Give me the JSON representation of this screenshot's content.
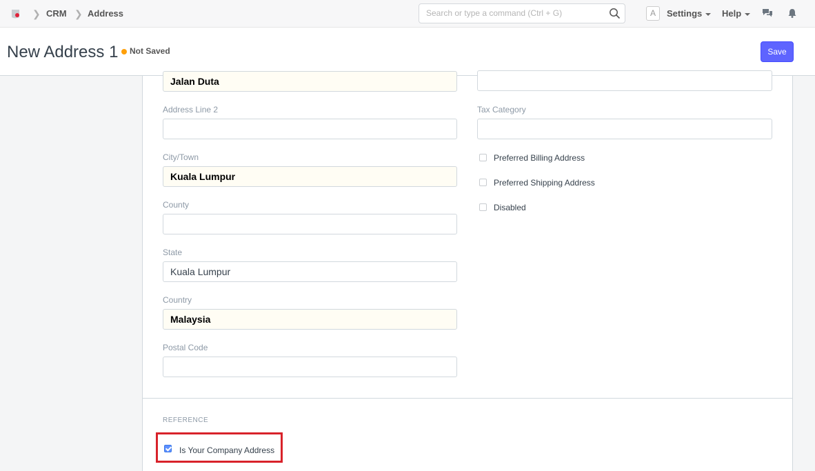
{
  "navbar": {
    "breadcrumbs": [
      "CRM",
      "Address"
    ],
    "search_placeholder": "Search or type a command (Ctrl + G)",
    "avatar_letter": "A",
    "settings_label": "Settings",
    "help_label": "Help",
    "icons": [
      "app-logo-icon",
      "search-icon",
      "chat-icon",
      "bell-icon"
    ]
  },
  "page": {
    "title": "New Address 1",
    "status": "Not Saved",
    "status_color": "#ffa00a",
    "save_label": "Save",
    "accent_color": "#5e64ff"
  },
  "form": {
    "address_line1_value": "Jalan Duta",
    "address_line2_label": "Address Line 2",
    "address_line2_value": "",
    "city_label": "City/Town",
    "city_value": "Kuala Lumpur",
    "county_label": "County",
    "county_value": "",
    "state_label": "State",
    "state_value": "Kuala Lumpur",
    "country_label": "Country",
    "country_value": "Malaysia",
    "postal_label": "Postal Code",
    "postal_value": "",
    "tax_category_label": "Tax Category",
    "tax_category_value": "",
    "right_top_value": "",
    "checkboxes": [
      {
        "label": "Preferred Billing Address",
        "checked": false
      },
      {
        "label": "Preferred Shipping Address",
        "checked": false
      },
      {
        "label": "Disabled",
        "checked": false
      }
    ]
  },
  "reference": {
    "section_label": "REFERENCE",
    "company_address_label": "Is Your Company Address",
    "company_address_checked": true,
    "highlight_color": "#d8222a"
  }
}
